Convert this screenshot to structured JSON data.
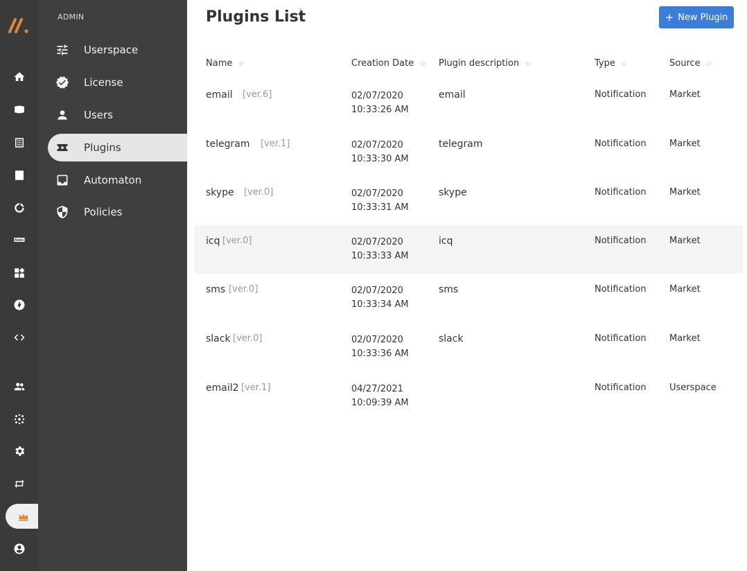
{
  "rail": {
    "items": [
      {
        "name": "home-icon"
      },
      {
        "name": "cube-icon"
      },
      {
        "name": "grid-icon"
      },
      {
        "name": "archive-icon"
      },
      {
        "name": "circle-icon"
      },
      {
        "name": "ruler-icon"
      },
      {
        "name": "widgets-icon"
      },
      {
        "name": "bolt-icon"
      },
      {
        "name": "code-icon"
      },
      {
        "name": "group-icon"
      },
      {
        "name": "scatter-icon"
      },
      {
        "name": "settings-icon"
      },
      {
        "name": "swap-icon"
      },
      {
        "name": "crown-icon"
      },
      {
        "name": "account-icon"
      }
    ]
  },
  "subnav": {
    "section": "ADMIN",
    "items": [
      {
        "label": "Userspace",
        "icon": "sliders-icon"
      },
      {
        "label": "License",
        "icon": "verified-icon"
      },
      {
        "label": "Users",
        "icon": "user-icon"
      },
      {
        "label": "Plugins",
        "icon": "plugin-icon"
      },
      {
        "label": "Automaton",
        "icon": "inbox-icon"
      },
      {
        "label": "Policies",
        "icon": "shield-icon"
      }
    ],
    "active": "Plugins"
  },
  "main": {
    "title": "Plugins List",
    "count": "7",
    "new_button": "New Plugin",
    "columns": [
      "Name",
      "Creation Date",
      "Plugin description",
      "Type",
      "Source"
    ],
    "rows": [
      {
        "name": "email",
        "ver": "[ver.6]",
        "date": "02/07/2020",
        "time": "10:33:26 AM",
        "desc": "email",
        "type": "Notification",
        "source": "Market"
      },
      {
        "name": "telegram",
        "ver": "[ver.1]",
        "date": "02/07/2020",
        "time": "10:33:30 AM",
        "desc": "telegram",
        "type": "Notification",
        "source": "Market"
      },
      {
        "name": "skype",
        "ver": "[ver.0]",
        "date": "02/07/2020",
        "time": "10:33:31 AM",
        "desc": "skype",
        "type": "Notification",
        "source": "Market"
      },
      {
        "name": "icq",
        "ver": "[ver.0]",
        "date": "02/07/2020",
        "time": "10:33:33 AM",
        "desc": "icq",
        "type": "Notification",
        "source": "Market"
      },
      {
        "name": "sms",
        "ver": "[ver.0]",
        "date": "02/07/2020",
        "time": "10:33:34 AM",
        "desc": "sms",
        "type": "Notification",
        "source": "Market"
      },
      {
        "name": "slack",
        "ver": "[ver.0]",
        "date": "02/07/2020",
        "time": "10:33:36 AM",
        "desc": "slack",
        "type": "Notification",
        "source": "Market"
      },
      {
        "name": "email2",
        "ver": "[ver.1]",
        "date": "04/27/2021",
        "time": "10:09:39 AM",
        "desc": "",
        "type": "Notification",
        "source": "Userspace"
      }
    ]
  },
  "colors": {
    "rail_bg": "#3a3a3a",
    "subnav_bg": "#3f3f3f",
    "accent": "#3b7dd8",
    "logo": "#d98a3d"
  }
}
